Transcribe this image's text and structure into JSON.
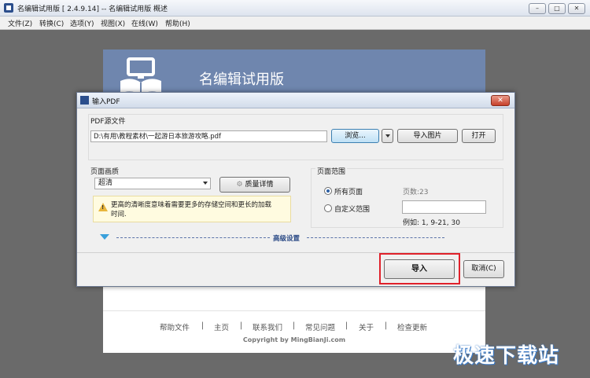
{
  "window": {
    "title": "名编辑试用版 [ 2.4.9.14] -- 名编辑试用版 概述",
    "minimize": "–",
    "maximize": "□",
    "close": "✕"
  },
  "menu": [
    "文件(Z)",
    "转换(C)",
    "选项(Y)",
    "视图(X)",
    "在线(W)",
    "帮助(H)"
  ],
  "page": {
    "title": "名编辑试用版",
    "footer_links": [
      "帮助文件",
      "主页",
      "联系我们",
      "常见问题",
      "关于",
      "检查更新"
    ],
    "separator": "|",
    "copyright": "Copyright by MingBianJi.com"
  },
  "dialog": {
    "title": "输入PDF",
    "close": "✕",
    "source_label": "PDF源文件",
    "source_path": "D:\\有用\\教程素材\\一起游日本旅游攻略.pdf",
    "browse": "浏览...",
    "import_image": "导入图片",
    "open": "打开",
    "quality_label": "页面画质",
    "quality_value": "超清",
    "quality_detail": "质量详情",
    "warning": "更高的清晰度意味着需要更多的存储空间和更长的加载时间.",
    "range_label": "页面范围",
    "all_pages": "所有页面",
    "page_count": "页数:23",
    "custom_range": "自定义范围",
    "example": "例如: 1, 9-21, 30",
    "advanced": "高级设置",
    "import": "导入",
    "cancel": "取消(C)"
  },
  "watermark": "极速下载站",
  "colors": {
    "header": "#6f86ae",
    "highlight": "#e0212b",
    "accent": "#39a0db"
  }
}
